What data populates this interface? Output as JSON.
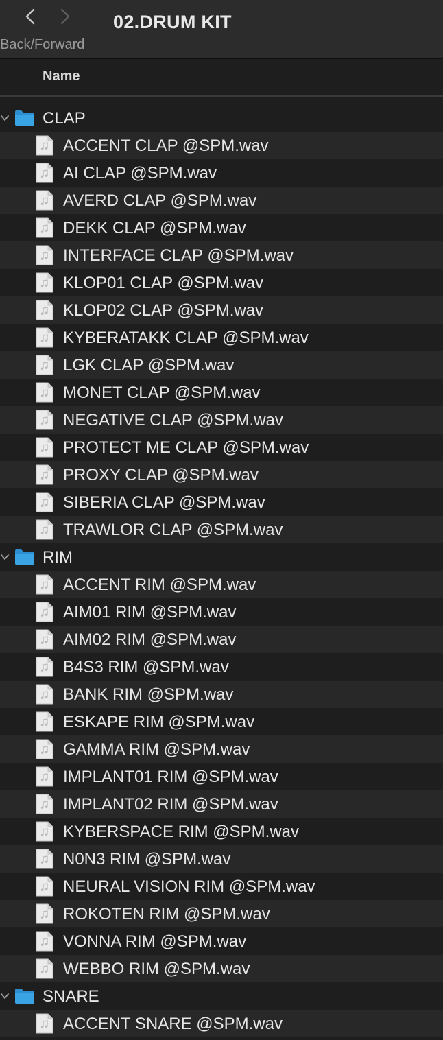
{
  "toolbar": {
    "nav_caption": "Back/Forward",
    "title": "02.DRUM KIT"
  },
  "columns": {
    "name": "Name"
  },
  "colors": {
    "folder": "#3aa3e3",
    "background": "#1e1e1e",
    "alt_row": "#282828"
  },
  "groups": [
    {
      "name": "CLAP",
      "expanded": true,
      "files": [
        "ACCENT CLAP @SPM.wav",
        "AI CLAP @SPM.wav",
        "AVERD CLAP @SPM.wav",
        "DEKK CLAP @SPM.wav",
        "INTERFACE CLAP @SPM.wav",
        "KLOP01 CLAP @SPM.wav",
        "KLOP02 CLAP @SPM.wav",
        "KYBERATAKK CLAP @SPM.wav",
        "LGK CLAP @SPM.wav",
        "MONET CLAP @SPM.wav",
        "NEGATIVE CLAP @SPM.wav",
        "PROTECT ME CLAP @SPM.wav",
        "PROXY CLAP @SPM.wav",
        "SIBERIA CLAP @SPM.wav",
        "TRAWLOR CLAP @SPM.wav"
      ]
    },
    {
      "name": "RIM",
      "expanded": true,
      "files": [
        "ACCENT RIM @SPM.wav",
        "AIM01 RIM @SPM.wav",
        "AIM02 RIM @SPM.wav",
        "B4S3 RIM @SPM.wav",
        "BANK RIM @SPM.wav",
        "ESKAPE RIM @SPM.wav",
        "GAMMA RIM @SPM.wav",
        "IMPLANT01 RIM @SPM.wav",
        "IMPLANT02 RIM @SPM.wav",
        "KYBERSPACE RIM @SPM.wav",
        "N0N3 RIM @SPM.wav",
        "NEURAL VISION RIM @SPM.wav",
        "ROKOTEN RIM @SPM.wav",
        "VONNA RIM @SPM.wav",
        "WEBBO RIM @SPM.wav"
      ]
    },
    {
      "name": "SNARE",
      "expanded": true,
      "files": [
        "ACCENT SNARE @SPM.wav"
      ]
    }
  ]
}
